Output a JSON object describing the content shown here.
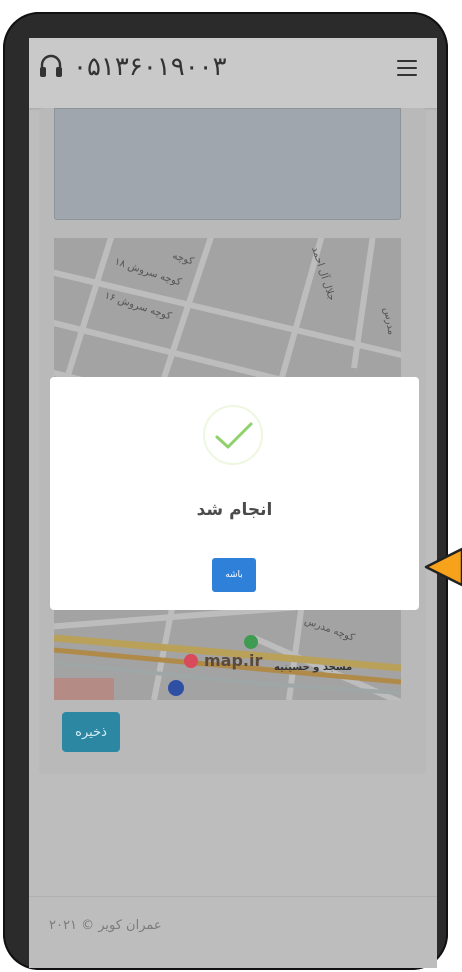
{
  "header": {
    "phone_number": "۰۵۱۳۶۰۱۹۰۰۳",
    "support_icon": "headset-icon",
    "menu_icon": "hamburger-menu-icon"
  },
  "map": {
    "streets": [
      "کوچه",
      "کوچه سروش ۱۸",
      "کوچه سروش ۱۶",
      "جلال آل احمد",
      "مدرس",
      "کوچه مدرس",
      "مسجد و حسینیه"
    ],
    "logo": "map.ir",
    "toolbar_icons": [
      "close-circle-icon",
      "copy-icon",
      "link-icon"
    ]
  },
  "form": {
    "save_label": "ذخیره"
  },
  "footer": {
    "copyright": "عمران کویر © ۲۰۲۱"
  },
  "dialog": {
    "title": "انجام شد",
    "ok_label": "باشه",
    "icon": "checkmark-icon"
  },
  "colors": {
    "accent_blue": "#2f80d8",
    "save_teal": "#2c87a3",
    "success_green": "#8fd16b",
    "arrow_orange": "#f7a21b"
  }
}
